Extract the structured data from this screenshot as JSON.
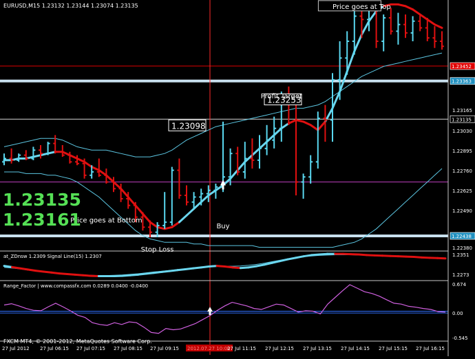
{
  "colors": {
    "background": "#000000",
    "axis": "#c8c8c8",
    "bull": "#5ad8f0",
    "bear": "#e01010",
    "ma": "#6bd6ee",
    "band": "#5cc6e2",
    "level_line": "#d8d8d8",
    "magenta_line": "#c040c0",
    "red_line": "#e00000",
    "osc": "#d060e0",
    "zero_line": "#3070ff",
    "big_text": "#55e055",
    "cursor": "#ff2a2a"
  },
  "chart_data": {
    "type": "candlestick",
    "symbol_header": "EURUSD,M15  1.23132 1.23144 1.23074 1.23135",
    "y_ticks": [
      "1.23165",
      "1.23030",
      "1.22895",
      "1.22760",
      "1.22625",
      "1.22490",
      "1.22380"
    ],
    "price_labels": [
      {
        "text": "1.23135",
        "value": 1.23135,
        "style": "white-box"
      },
      {
        "text": "1.23098",
        "value": 1.23098,
        "style": "white-box"
      },
      {
        "text": "1.23253",
        "value": 1.23253,
        "style": "white-box"
      },
      {
        "text": "1.22438",
        "value": 1.22438,
        "style": "blue-box"
      },
      {
        "text": "1.23363",
        "value": 1.23363,
        "style": "blue-box"
      },
      {
        "text": "1.23452",
        "value": 1.23452,
        "style": "red-box"
      }
    ],
    "horizontal_levels": [
      {
        "name": "stop-loss",
        "value": 1.22438,
        "style": "thick"
      },
      {
        "name": "target-level",
        "value": 1.23363,
        "style": "thick"
      },
      {
        "name": "red-level",
        "value": 1.23452,
        "style": "red"
      },
      {
        "name": "entry-level",
        "value": 1.23135,
        "style": "thin"
      },
      {
        "name": "magenta-level",
        "value": 1.2276,
        "style": "magenta"
      }
    ],
    "ylim": [
      1.2236,
      1.2383
    ],
    "candles": [
      [
        1.2288,
        1.2293,
        1.2286,
        1.229
      ],
      [
        1.229,
        1.2296,
        1.2287,
        1.2289
      ],
      [
        1.2289,
        1.2293,
        1.2288,
        1.2292
      ],
      [
        1.2292,
        1.2295,
        1.2289,
        1.229
      ],
      [
        1.229,
        1.2297,
        1.2289,
        1.2295
      ],
      [
        1.2295,
        1.2298,
        1.229,
        1.2293
      ],
      [
        1.2293,
        1.23,
        1.2292,
        1.2299
      ],
      [
        1.2299,
        1.2304,
        1.2293,
        1.2294
      ],
      [
        1.2294,
        1.2298,
        1.2291,
        1.2292
      ],
      [
        1.2292,
        1.2294,
        1.2287,
        1.2288
      ],
      [
        1.2288,
        1.2292,
        1.2286,
        1.2287
      ],
      [
        1.2287,
        1.229,
        1.2278,
        1.228
      ],
      [
        1.228,
        1.2286,
        1.2278,
        1.2282
      ],
      [
        1.2282,
        1.229,
        1.2279,
        1.228
      ],
      [
        1.228,
        1.2284,
        1.2275,
        1.2276
      ],
      [
        1.2276,
        1.2279,
        1.227,
        1.2272
      ],
      [
        1.2272,
        1.2275,
        1.2264,
        1.2266
      ],
      [
        1.2266,
        1.227,
        1.226,
        1.2262
      ],
      [
        1.2262,
        1.2264,
        1.2252,
        1.2255
      ],
      [
        1.2255,
        1.2258,
        1.2247,
        1.2249
      ],
      [
        1.2249,
        1.2253,
        1.2243,
        1.2246
      ],
      [
        1.2246,
        1.2252,
        1.2243,
        1.225
      ],
      [
        1.225,
        1.227,
        1.2248,
        1.2252
      ],
      [
        1.2252,
        1.2285,
        1.225,
        1.2283
      ],
      [
        1.2283,
        1.229,
        1.2266,
        1.2268
      ],
      [
        1.2268,
        1.2274,
        1.2262,
        1.2264
      ],
      [
        1.2264,
        1.227,
        1.226,
        1.2267
      ],
      [
        1.2267,
        1.2272,
        1.2262,
        1.2269
      ],
      [
        1.2269,
        1.2274,
        1.2264,
        1.2271
      ],
      [
        1.2271,
        1.2275,
        1.2266,
        1.2273
      ],
      [
        1.2273,
        1.2312,
        1.227,
        1.2279
      ],
      [
        1.2279,
        1.2296,
        1.2274,
        1.2293
      ],
      [
        1.2293,
        1.2297,
        1.228,
        1.2282
      ],
      [
        1.2282,
        1.23,
        1.2278,
        1.229
      ],
      [
        1.229,
        1.2302,
        1.2284,
        1.2289
      ],
      [
        1.2289,
        1.2304,
        1.2284,
        1.2296
      ],
      [
        1.2296,
        1.231,
        1.2292,
        1.2301
      ],
      [
        1.2301,
        1.2315,
        1.2296,
        1.2308
      ],
      [
        1.2308,
        1.233,
        1.23,
        1.2325
      ],
      [
        1.2325,
        1.2333,
        1.231,
        1.2324
      ],
      [
        1.2324,
        1.2328,
        1.2268,
        1.2276
      ],
      [
        1.2276,
        1.2281,
        1.2266,
        1.2279
      ],
      [
        1.2279,
        1.2292,
        1.2275,
        1.2288
      ],
      [
        1.2288,
        1.2318,
        1.2284,
        1.2314
      ],
      [
        1.2314,
        1.2322,
        1.23,
        1.2313
      ],
      [
        1.2313,
        1.2341,
        1.23,
        1.2337
      ],
      [
        1.2337,
        1.236,
        1.2325,
        1.235
      ],
      [
        1.235,
        1.2366,
        1.234,
        1.236
      ],
      [
        1.236,
        1.238,
        1.2352,
        1.2375
      ],
      [
        1.2375,
        1.2382,
        1.2362,
        1.2373
      ],
      [
        1.2373,
        1.2383,
        1.2366,
        1.2379
      ],
      [
        1.2379,
        1.2383,
        1.2356,
        1.236
      ],
      [
        1.236,
        1.2376,
        1.2354,
        1.2374
      ],
      [
        1.2374,
        1.238,
        1.2364,
        1.2366
      ],
      [
        1.2366,
        1.2377,
        1.2358,
        1.237
      ],
      [
        1.237,
        1.2376,
        1.2362,
        1.2365
      ],
      [
        1.2365,
        1.2375,
        1.236,
        1.2372
      ],
      [
        1.2372,
        1.2376,
        1.2366,
        1.2368
      ],
      [
        1.2368,
        1.2374,
        1.236,
        1.2362
      ],
      [
        1.2362,
        1.2369,
        1.2356,
        1.236
      ],
      [
        1.236,
        1.2366,
        1.2355,
        1.2357
      ]
    ],
    "ma": [
      1.2289,
      1.2289,
      1.229,
      1.229,
      1.2291,
      1.2292,
      1.2293,
      1.2294,
      1.2294,
      1.2292,
      1.229,
      1.2288,
      1.2285,
      1.2283,
      1.228,
      1.2276,
      1.2272,
      1.2267,
      1.2262,
      1.2257,
      1.2252,
      1.2249,
      1.2248,
      1.2249,
      1.2252,
      1.2256,
      1.226,
      1.2264,
      1.2268,
      1.2271,
      1.2274,
      1.2278,
      1.2283,
      1.2288,
      1.2292,
      1.2296,
      1.23,
      1.2304,
      1.2308,
      1.2311,
      1.2313,
      1.2312,
      1.231,
      1.2307,
      1.2312,
      1.232,
      1.233,
      1.2342,
      1.2354,
      1.2364,
      1.2372,
      1.2378,
      1.2381,
      1.2382,
      1.2382,
      1.2381,
      1.2379,
      1.2376,
      1.2373,
      1.237,
      1.2368
    ],
    "ma_bear_ranges": [
      [
        8,
        24
      ],
      [
        40,
        44
      ],
      [
        53,
        61
      ]
    ],
    "upper_band": [
      1.2297,
      1.2298,
      1.2299,
      1.23,
      1.2301,
      1.2302,
      1.2302,
      1.2302,
      1.2301,
      1.2299,
      1.2297,
      1.2296,
      1.2295,
      1.2295,
      1.2295,
      1.2294,
      1.2293,
      1.2292,
      1.2291,
      1.2291,
      1.2291,
      1.2292,
      1.2293,
      1.2295,
      1.2298,
      1.2301,
      1.2303,
      1.2305,
      1.2307,
      1.2309,
      1.231,
      1.2311,
      1.2312,
      1.2313,
      1.2314,
      1.2315,
      1.2316,
      1.2317,
      1.2318,
      1.2319,
      1.232,
      1.232,
      1.2321,
      1.2322,
      1.2324,
      1.2327,
      1.233,
      1.2333,
      1.2336,
      1.2339,
      1.2341,
      1.2343,
      1.2345,
      1.2346,
      1.2347,
      1.2348,
      1.2349,
      1.235,
      1.2351,
      1.2352,
      1.2353
    ],
    "lower_band": [
      1.2282,
      1.2282,
      1.2282,
      1.2281,
      1.2281,
      1.2281,
      1.228,
      1.228,
      1.2279,
      1.2278,
      1.2276,
      1.2273,
      1.227,
      1.2267,
      1.2263,
      1.2259,
      1.2255,
      1.2251,
      1.2247,
      1.2244,
      1.2242,
      1.2241,
      1.224,
      1.224,
      1.224,
      1.224,
      1.2239,
      1.2239,
      1.2238,
      1.2238,
      1.2238,
      1.2238,
      1.2238,
      1.2238,
      1.2238,
      1.2237,
      1.2237,
      1.2237,
      1.2237,
      1.2237,
      1.2237,
      1.2237,
      1.2237,
      1.2237,
      1.2237,
      1.2237,
      1.2238,
      1.2239,
      1.224,
      1.2242,
      1.2245,
      1.2248,
      1.2252,
      1.2256,
      1.226,
      1.2264,
      1.2268,
      1.2272,
      1.2276,
      1.228,
      1.2284
    ],
    "annotations": [
      {
        "text": "Price goes at Top",
        "bar": 49,
        "value": 1.2381,
        "style": "boxed"
      },
      {
        "text": "Profit Target",
        "bar": 38,
        "value": 1.23275,
        "style": "plain"
      },
      {
        "text": "Price goes at Bottom",
        "bar": 14,
        "value": 1.22535,
        "style": "plain"
      },
      {
        "text": "Stop Loss",
        "bar": 21,
        "value": 1.2236,
        "style": "plain"
      },
      {
        "text": "Buy",
        "bar": 30,
        "value": 1.225,
        "style": "plain"
      }
    ],
    "buy_arrow": {
      "bar": 30,
      "value": 1.2274
    },
    "big_numbers": [
      "1.23135",
      "1.23161"
    ],
    "oscillator1": {
      "title": "at_ZDnsw 1.2309  Signal Line(15) 1.2307",
      "y_ticks": [
        "1.2351",
        "1.2273"
      ],
      "ylim": [
        1.2268,
        1.2355
      ],
      "line": [
        1.231,
        1.2306,
        1.2302,
        1.2298,
        1.2294,
        1.2291,
        1.2288,
        1.2285,
        1.2283,
        1.2281,
        1.2279,
        1.2277,
        1.2276,
        1.2276,
        1.2276,
        1.2277,
        1.2279,
        1.2281,
        1.2284,
        1.2287,
        1.229,
        1.2293,
        1.2296,
        1.2299,
        1.2302,
        1.2305,
        1.2308,
        1.231,
        1.2308,
        1.2305,
        1.2303,
        1.2305,
        1.2309,
        1.2314,
        1.232,
        1.2326,
        1.2332,
        1.2337,
        1.2342,
        1.2346,
        1.2348,
        1.235,
        1.235,
        1.235,
        1.2349,
        1.2348,
        1.2346,
        1.2345,
        1.2344,
        1.2343,
        1.2342,
        1.2341,
        1.234,
        1.2338,
        1.2337,
        1.2336,
        1.2335
      ],
      "signal": [
        1.2305,
        1.2303,
        1.23,
        1.2296,
        1.2293,
        1.229,
        1.2287,
        1.2285,
        1.2283,
        1.2281,
        1.228,
        1.2279,
        1.2278,
        1.2278,
        1.2279,
        1.228,
        1.2282,
        1.2284,
        1.2287,
        1.229,
        1.2292,
        1.2295,
        1.2298,
        1.23,
        1.2303,
        1.2305,
        1.2307,
        1.2308,
        1.2309,
        1.2309,
        1.231,
        1.2312,
        1.2315,
        1.2319,
        1.2324,
        1.2329,
        1.2334,
        1.2338,
        1.2341,
        1.2343,
        1.2345,
        1.2346,
        1.2347,
        1.2347,
        1.2347,
        1.2346,
        1.2346,
        1.2345,
        1.2344,
        1.2343,
        1.2342,
        1.2341,
        1.234,
        1.2339,
        1.2338,
        1.2337,
        1.2336
      ],
      "bear_ranges": [
        [
          2,
          12
        ],
        [
          28,
          30
        ],
        [
          43,
          56
        ]
      ]
    },
    "oscillator2": {
      "title": "Range_Factor | www.compassfx.com    0.0289 0.0400 -0.0400",
      "y_ticks": [
        "0.674",
        "0.00",
        "-0.545"
      ],
      "ylim": [
        -0.62,
        0.7
      ],
      "zero_line": 0,
      "upper_line": 0.04,
      "values": [
        0.18,
        0.21,
        0.16,
        0.1,
        0.06,
        0.05,
        0.14,
        0.22,
        0.14,
        0.05,
        -0.05,
        -0.1,
        -0.22,
        -0.26,
        -0.28,
        -0.22,
        -0.26,
        -0.2,
        -0.22,
        -0.32,
        -0.44,
        -0.46,
        -0.35,
        -0.38,
        -0.36,
        -0.3,
        -0.24,
        -0.15,
        -0.06,
        0.06,
        0.16,
        0.24,
        0.2,
        0.16,
        0.1,
        0.08,
        0.14,
        0.2,
        0.18,
        0.1,
        0.02,
        0.05,
        0.04,
        -0.02,
        0.2,
        0.35,
        0.5,
        0.64,
        0.56,
        0.48,
        0.44,
        0.38,
        0.3,
        0.22,
        0.2,
        0.15,
        0.13,
        0.1,
        0.08,
        0.03,
        0.02
      ]
    },
    "x_tick_labels": [
      "27 Jul 2012",
      "27 Jul 06:15",
      "27 Jul 07:15",
      "27 Jul 08:15",
      "27 Jul 09:15",
      "2012.07.27 10:00",
      "27 Jul 11:15",
      "27 Jul 12:15",
      "27 Jul 13:15",
      "27 Jul 14:15",
      "27 Jul 15:15",
      "27 Jul 16:15"
    ],
    "cursor_time_label": "2012.07.27 10:00",
    "footer": "FXCM MT4, © 2001-2012, MetaQuotes Software Corp."
  }
}
